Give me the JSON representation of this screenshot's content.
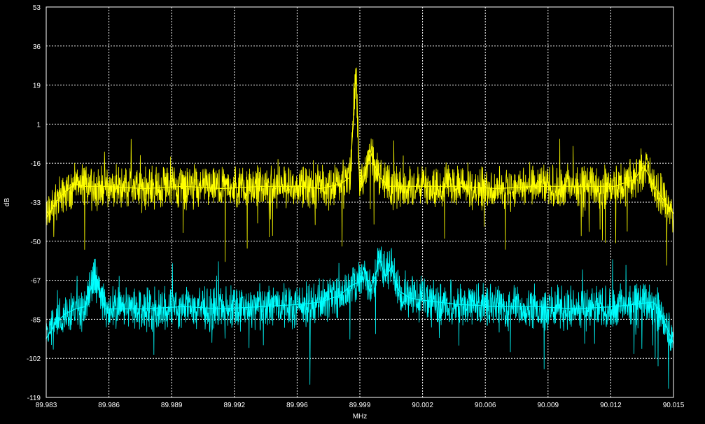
{
  "chart_data": {
    "type": "line",
    "title": "",
    "xlabel": "MHz",
    "ylabel": "dB",
    "x_ticks": [
      "89.983",
      "89.986",
      "89.989",
      "89.992",
      "89.996",
      "89.999",
      "90.002",
      "90.006",
      "90.009",
      "90.012",
      "90.015"
    ],
    "y_ticks": [
      "53",
      "36",
      "19",
      "1",
      "-16",
      "-33",
      "-50",
      "-67",
      "-85",
      "-102",
      "-119"
    ],
    "xlim": [
      89.983,
      90.015
    ],
    "ylim": [
      -119,
      53
    ],
    "grid": true,
    "background": "#000000",
    "grid_color": "#ffffff",
    "series": [
      {
        "color": "#ffff00",
        "x": [
          89.983,
          89.9835,
          89.984,
          89.9845,
          89.985,
          89.986,
          89.988,
          89.99,
          89.992,
          89.994,
          89.996,
          89.997,
          89.998,
          89.9985,
          89.9988,
          89.999,
          89.9992,
          89.9995,
          90.0,
          90.0005,
          90.001,
          90.002,
          90.004,
          90.006,
          90.008,
          90.01,
          90.012,
          90.013,
          90.0135,
          90.014,
          90.0145,
          90.015
        ],
        "values": [
          -40,
          -33,
          -28,
          -25,
          -26,
          -26,
          -27,
          -26,
          -27,
          -26,
          -26,
          -27,
          -25,
          -22,
          25,
          -28,
          -24,
          -10,
          -22,
          -26,
          -26,
          -26,
          -26,
          -27,
          -26,
          -26,
          -26,
          -23,
          -17,
          -26,
          -32,
          -38
        ]
      },
      {
        "color": "#00ffff",
        "x": [
          89.983,
          89.9835,
          89.984,
          89.9845,
          89.985,
          89.9855,
          89.986,
          89.988,
          89.99,
          89.992,
          89.994,
          89.996,
          89.997,
          89.998,
          89.9985,
          89.999,
          89.9992,
          89.9995,
          89.9998,
          90.0,
          90.0003,
          90.0006,
          90.001,
          90.0015,
          90.002,
          90.004,
          90.006,
          90.008,
          90.01,
          90.012,
          90.013,
          90.014,
          90.0145,
          90.015
        ],
        "values": [
          -93,
          -86,
          -82,
          -80,
          -79,
          -65,
          -80,
          -80,
          -79,
          -80,
          -79,
          -78,
          -77,
          -74,
          -70,
          -68,
          -62,
          -72,
          -65,
          -58,
          -66,
          -62,
          -72,
          -75,
          -76,
          -78,
          -79,
          -79,
          -80,
          -79,
          -78,
          -77,
          -85,
          -95
        ]
      }
    ]
  }
}
